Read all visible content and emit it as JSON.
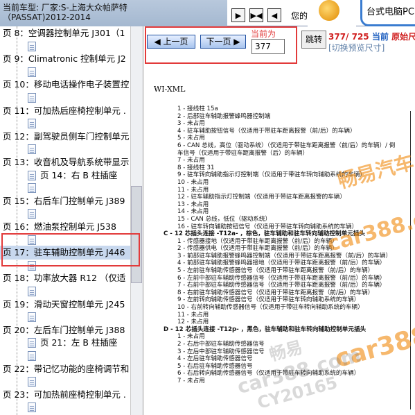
{
  "header": {
    "car_title_line1": "当前车型:   厂家:S-上海大众帕萨特",
    "car_title_line2": "（PASSAT)2012-2014",
    "nav_buttons": [
      "▶",
      "▶◀",
      "◀"
    ],
    "top_text": "您的",
    "ad_text": "台式电脑PC"
  },
  "sidebar": {
    "items": [
      {
        "label": "页 8：空调器控制单元 J301（1",
        "level": 0
      },
      {
        "label": "",
        "level": 1
      },
      {
        "label": "页 9：Climatronic 控制单元 J2",
        "level": 0
      },
      {
        "label": "",
        "level": 1
      },
      {
        "label": "页 10：移动电话操作电子装置控",
        "level": 0
      },
      {
        "label": "",
        "level": 1
      },
      {
        "label": "页 11：可加热后座椅控制单元 .",
        "level": 0
      },
      {
        "label": "",
        "level": 1
      },
      {
        "label": "页 12：副驾驶员侧车门控制单元",
        "level": 0
      },
      {
        "label": "",
        "level": 1
      },
      {
        "label": "页 13：收音机及导航系统带显示",
        "level": 0
      },
      {
        "label": "页 14：右 B 柱插座",
        "level": 1
      },
      {
        "label": "",
        "level": 1
      },
      {
        "label": "页 15：右后车门控制单元 J389",
        "level": 0
      },
      {
        "label": "",
        "level": 1
      },
      {
        "label": "页 16：燃油泵控制单元 J538",
        "level": 0
      },
      {
        "label": "",
        "level": 1
      },
      {
        "label": "页 17：驻车辅助控制单元 J446",
        "level": 0
      },
      {
        "label": "",
        "level": 1
      },
      {
        "label": "页 18：功率放大器 R12 （仅适",
        "level": 0
      },
      {
        "label": "",
        "level": 1
      },
      {
        "label": "页 19：滑动天窗控制单元 J245",
        "level": 0
      },
      {
        "label": "",
        "level": 1
      },
      {
        "label": "页 20：左后车门控制单元 J388",
        "level": 0
      },
      {
        "label": "页 21：左 B 柱插座",
        "level": 1
      },
      {
        "label": "",
        "level": 1
      },
      {
        "label": "页 22：带记忆功能的座椅调节和",
        "level": 0
      },
      {
        "label": "",
        "level": 1
      },
      {
        "label": "页 23：可加热前座椅控制单元 .",
        "level": 0
      },
      {
        "label": "",
        "level": 1
      }
    ]
  },
  "pager": {
    "prev_label": "上一页",
    "next_label": "下一页",
    "current_label": "当前为",
    "page_value": "377",
    "jump_label": "跳转",
    "count_text": "377/ 725",
    "current_text": "当前",
    "original_text": "原始尺",
    "preview_text": "[切换预览尺寸]"
  },
  "document": {
    "title": "WI-XML",
    "lines": [
      {
        "text": "1 - 接线柱 15a",
        "type": "sub"
      },
      {
        "text": "2 - 后部驻车辅助报警蜂鸣器控制端",
        "type": "sub"
      },
      {
        "text": "3 - 未占用",
        "type": "sub"
      },
      {
        "text": "4 - 驻车辅助按钮信号（仅适用于带驻车距离报警（前/后）的车辆）",
        "type": "sub"
      },
      {
        "text": "5 - 未占用",
        "type": "sub"
      },
      {
        "text": "6 - CAN 总线，高位（驱动系统）（仅适用于带驻车距离报警（前/后）的车辆）/ 倒",
        "type": "sub"
      },
      {
        "text": "     车信号（仅适用于带驻车距离报警（后）的车辆）",
        "type": "sub"
      },
      {
        "text": "7 - 未占用",
        "type": "sub"
      },
      {
        "text": "8 - 接线柱 31",
        "type": "sub"
      },
      {
        "text": "9 - 驻车转向辅助指示灯控制端（仅适用于带驻车转向辅助系统的车辆）",
        "type": "sub"
      },
      {
        "text": "10 - 未占用",
        "type": "sub"
      },
      {
        "text": "11 - 未占用",
        "type": "sub"
      },
      {
        "text": "12 - 驻车辅助指示灯控制端（仅适用于带驻车距离报警的车辆）",
        "type": "sub"
      },
      {
        "text": "13 - 未占用",
        "type": "sub"
      },
      {
        "text": "14 - 未占用",
        "type": "sub"
      },
      {
        "text": "15 - CAN 总线，低位（驱动系统）",
        "type": "sub"
      },
      {
        "text": "16 - 驻车转向辅助按钮信号（仅适用于带驻车转向辅助系统的车辆）",
        "type": "sub"
      },
      {
        "text": "C - 12 芯插头连接 -T12a- ，棕色，驻车辅助和驻车转向辅助控制单元插头",
        "type": "hdr"
      },
      {
        "text": "1 - 传感器接地（仅适用于带驻车距离报警（前/后）的车辆）",
        "type": "sub"
      },
      {
        "text": "2 - 传感器供电（仅适用于带驻车距离报警（前/后）的车辆）",
        "type": "sub"
      },
      {
        "text": "3 - 前部驻车辅助报警蜂鸣器控制端（仅适用于带驻车距离报警（前/后）的车辆）",
        "type": "sub"
      },
      {
        "text": "4 - 前部驻车辅助报警蜂鸣器接地（仅适用于带驻车距离报警（前/后）的车辆）",
        "type": "sub"
      },
      {
        "text": "5 - 左前驻车辅助传感器信号（仅适用于带驻车距离报警（前/后）的车辆）",
        "type": "sub"
      },
      {
        "text": "6 - 左前中部驻车辅助传感器信号（仅适用于带驻车距离报警（前/后）的车辆）",
        "type": "sub"
      },
      {
        "text": "7 - 右前中部驻车辅助传感器信号（仅适用于带驻车距离报警（前/后）的车辆）",
        "type": "sub"
      },
      {
        "text": "8 - 右前驻车辅助传感器信号（仅适用于带驻车距离报警（前/后）的车辆）",
        "type": "sub"
      },
      {
        "text": "9 - 左前转向辅助传感器信号（仅适用于带驻车转向辅助系统的车辆）",
        "type": "sub"
      },
      {
        "text": "10 - 右前转向辅助传感器信号（仅适用于带驻车转向辅助系统的车辆）",
        "type": "sub"
      },
      {
        "text": "11 - 未占用",
        "type": "sub"
      },
      {
        "text": "12 - 未占用",
        "type": "sub"
      },
      {
        "text": "D - 12 芯插头连接 -T12p- ，黑色，驻车辅助和驻车转向辅助控制单元插头",
        "type": "hdr"
      },
      {
        "text": "1 - 未占用",
        "type": "sub"
      },
      {
        "text": "2 - 右后中部驻车辅助传感器信号",
        "type": "sub"
      },
      {
        "text": "3 - 左后中部驻车辅助传感器信号",
        "type": "sub"
      },
      {
        "text": "4 - 左后驻车辅助传感器信号",
        "type": "sub"
      },
      {
        "text": "5 - 右后驻车辅助传感器信号",
        "type": "sub"
      },
      {
        "text": "6 - 右后转向辅助传感器信号（仅适用于带驻车转向辅助系统的车辆）",
        "type": "sub"
      },
      {
        "text": "7 - 未占用",
        "type": "sub"
      }
    ]
  },
  "watermarks": {
    "orange_1": "畅易汽车",
    "orange_2": "car388.com",
    "orange_3": "car388",
    "grey_1": "畅易",
    "grey_2": "car388.com",
    "grey_3": "CY20165"
  },
  "colors": {
    "highlight_red": "#e23a3a",
    "selected_row": "#c8d8ee",
    "count_red": "#d02020",
    "link_blue": "#2060c0"
  }
}
